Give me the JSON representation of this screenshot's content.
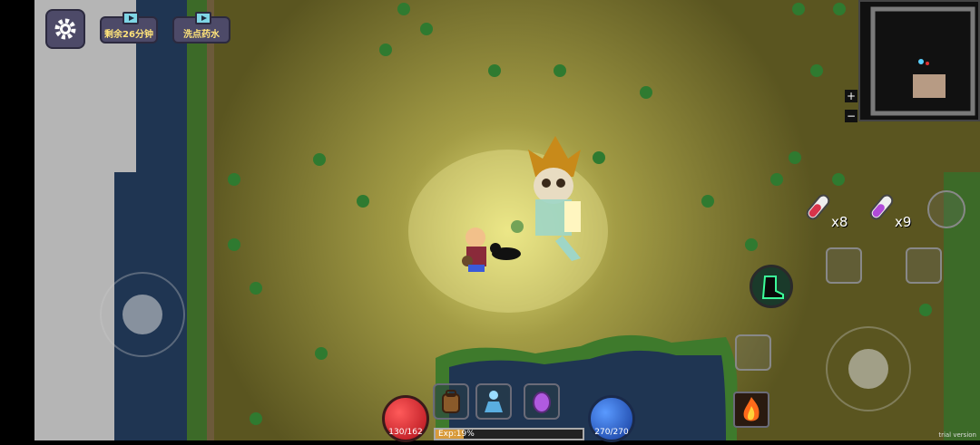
{
  "hud": {
    "settings_icon": "gear-icon",
    "time_remaining_button": "剩余26分钟",
    "reset_points_button": "洗点药水",
    "video_icon": "tv-play-icon"
  },
  "stats": {
    "hp_text": "130/162",
    "mp_text": "270/270",
    "exp_text": "Exp:19%",
    "exp_fraction": 0.19
  },
  "potions": [
    {
      "name": "health-potion",
      "count": "x8",
      "color": "#d8334a"
    },
    {
      "name": "mana-potion",
      "count": "x9",
      "color": "#b04ad8"
    }
  ],
  "skill_bar": [
    "bag-icon",
    "spirit-skill-icon",
    "egg-icon"
  ],
  "minimap": {
    "zoom_in": "+",
    "zoom_out": "−"
  },
  "footer": {
    "trial_text": "trial version"
  },
  "colors": {
    "ground": "#6f6a2b",
    "water": "#1e3350",
    "stone": "#b8b8b8",
    "hp": "#c8121c",
    "mp": "#1a55c8",
    "accent": "#ffe37a"
  }
}
